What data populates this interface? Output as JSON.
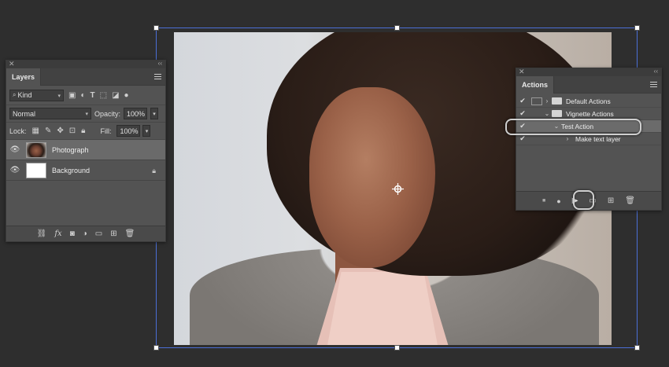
{
  "layers_panel": {
    "title": "Layers",
    "filter_kind": "Kind",
    "blend_mode": "Normal",
    "opacity_label": "Opacity:",
    "opacity_value": "100%",
    "lock_label": "Lock:",
    "fill_label": "Fill:",
    "fill_value": "100%",
    "layers": [
      {
        "name": "Photograph",
        "selected": true,
        "visible": true
      },
      {
        "name": "Background",
        "selected": false,
        "visible": true,
        "locked": true
      }
    ],
    "footer_icons": [
      "link-icon",
      "fx-icon",
      "mask-icon",
      "adjustment-icon",
      "folder-icon",
      "new-layer-icon",
      "trash-icon"
    ],
    "fx_label": "fx"
  },
  "actions_panel": {
    "title": "Actions",
    "items": [
      {
        "name": "Default Actions",
        "type": "set",
        "expanded": false,
        "checked": true
      },
      {
        "name": "Vignette Actions",
        "type": "set",
        "expanded": true,
        "checked": true
      },
      {
        "name": "Test Action",
        "type": "action",
        "expanded": true,
        "checked": true,
        "selected": true
      },
      {
        "name": "Make text layer",
        "type": "step",
        "expanded": false,
        "checked": true
      }
    ],
    "footer_icons": [
      "stop-icon",
      "record-icon",
      "play-icon",
      "folder-icon",
      "new-action-icon",
      "trash-icon"
    ]
  },
  "colors": {
    "app_bg": "#2e2e2e",
    "panel_bg": "#535353",
    "selection": "#6a6a6a",
    "bounding_box": "#4b6fd6"
  }
}
